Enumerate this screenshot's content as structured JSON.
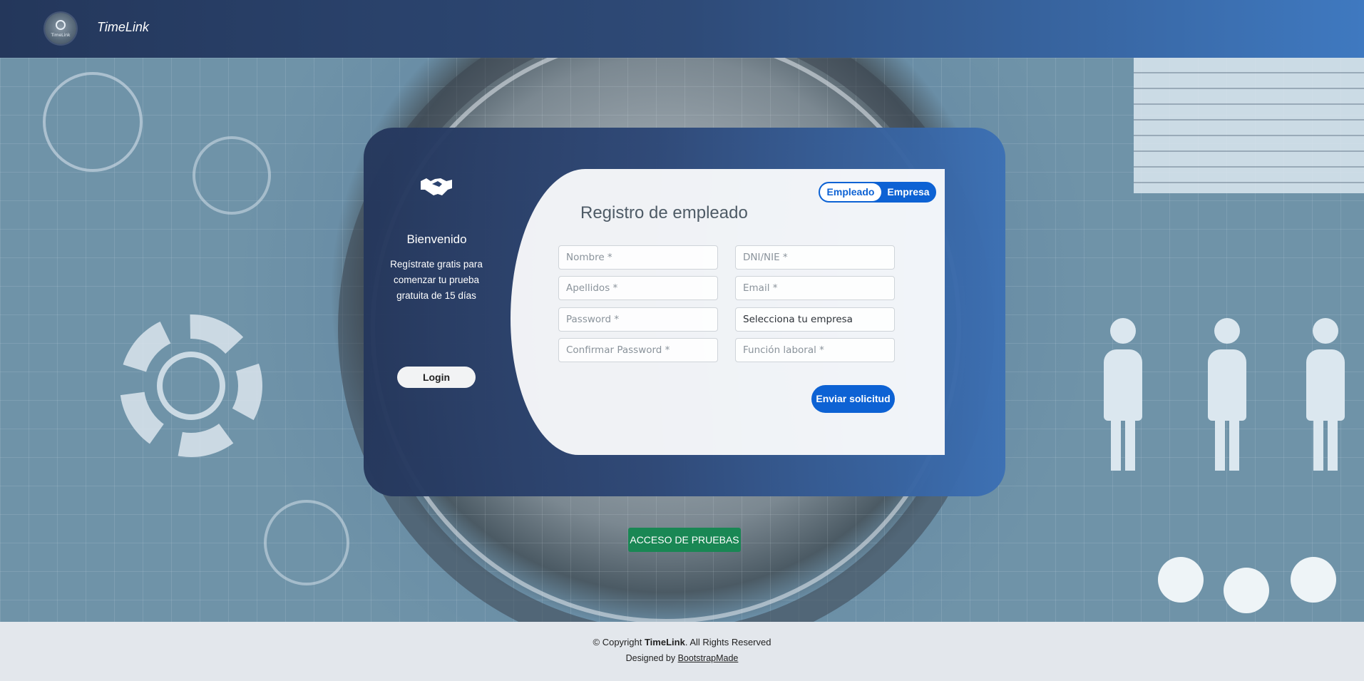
{
  "header": {
    "logo_text": "TimeLink",
    "brand": "TimeLink"
  },
  "sidebar": {
    "welcome": "Bienvenido",
    "subtitle": "Regístrate gratis para comenzar tu prueba gratuita de 15 días",
    "login_label": "Login"
  },
  "form": {
    "toggle": {
      "employee": "Empleado",
      "company": "Empresa",
      "active": "Empleado"
    },
    "title": "Registro de empleado",
    "fields": {
      "nombre": "Nombre *",
      "dni": "DNI/NIE *",
      "apellidos": "Apellidos *",
      "email": "Email *",
      "password": "Password *",
      "empresa": "Selecciona tu empresa",
      "confirm": "Confirmar Password *",
      "funcion": "Función laboral *"
    },
    "submit_label": "Enviar solicitud"
  },
  "test_access_label": "ACCESO DE PRUEBAS",
  "footer": {
    "copyright_prefix": "© Copyright ",
    "brand": "TimeLink",
    "copyright_suffix": ". All Rights Reserved",
    "designed_prefix": "Designed by ",
    "designed_link": "BootstrapMade"
  },
  "colors": {
    "primary": "#0d62d4",
    "success": "#198754",
    "card_dark": "#25375c",
    "card_light": "#3c70b4"
  }
}
